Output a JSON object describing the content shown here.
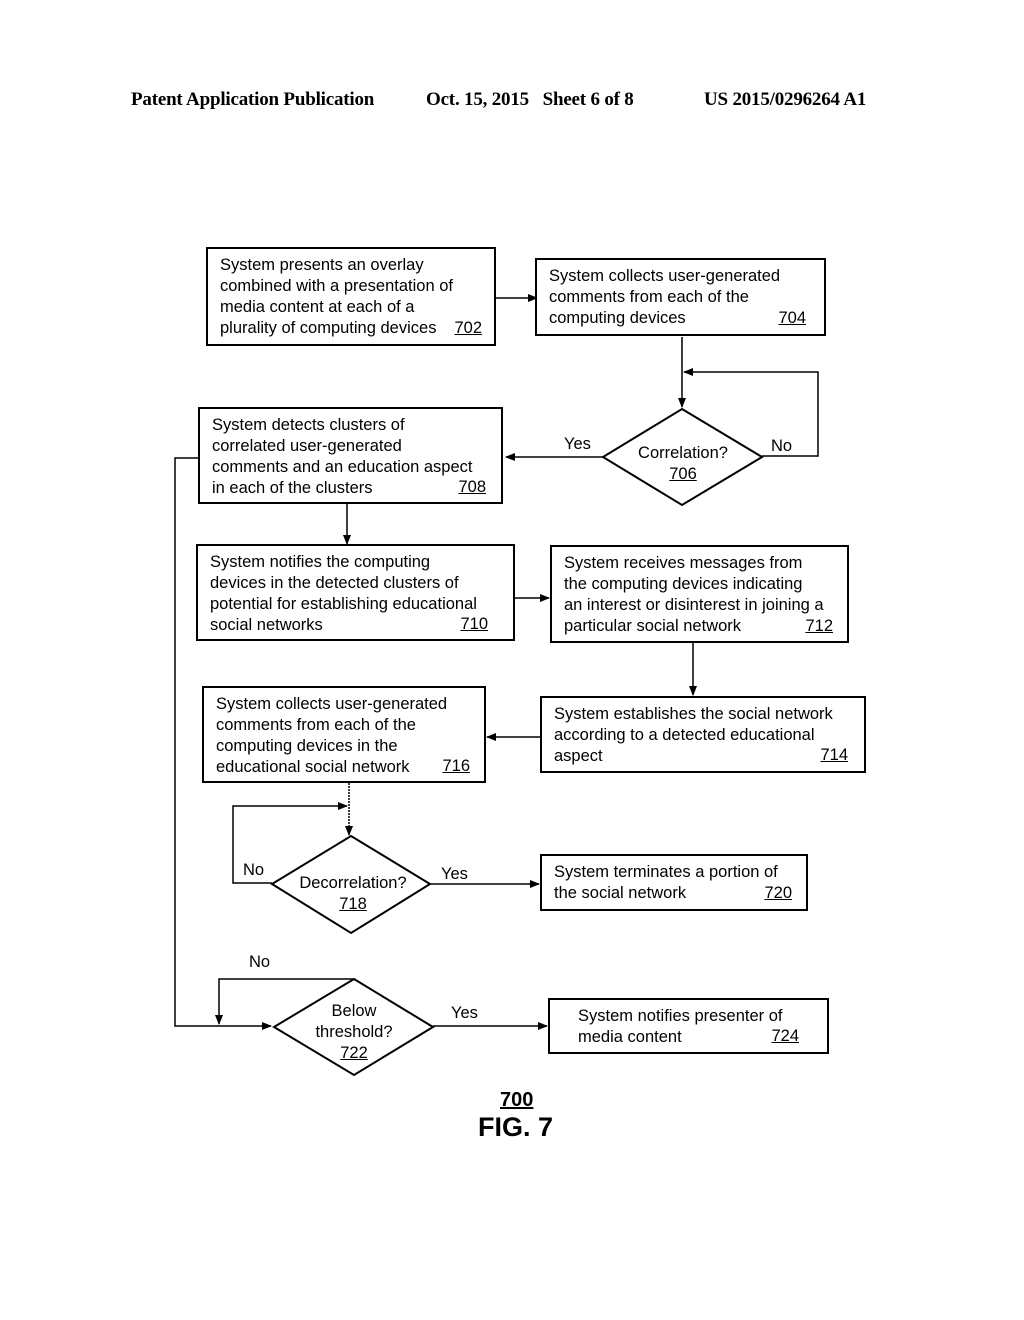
{
  "header": {
    "publication": "Patent Application Publication",
    "date_sheet": "Oct. 15, 2015   Sheet 6 of 8",
    "number": "US 2015/0296264 A1"
  },
  "nodes": {
    "n702": {
      "type": "process",
      "lines": [
        "System presents an overlay",
        "combined with a presentation of",
        "media content at each of a",
        "plurality of computing devices"
      ],
      "ref": "702"
    },
    "n704": {
      "type": "process",
      "lines": [
        "System collects user-generated",
        "comments from each of the",
        "computing devices"
      ],
      "ref": "704"
    },
    "n706": {
      "type": "decision",
      "lines": [
        "Correlation?"
      ],
      "ref": "706"
    },
    "n708": {
      "type": "process",
      "lines": [
        "System detects clusters of",
        "correlated user-generated",
        "comments and an education aspect",
        "in each of the clusters"
      ],
      "ref": "708"
    },
    "n710": {
      "type": "process",
      "lines": [
        "System notifies the computing",
        "devices in the detected clusters of",
        "potential for establishing  educational",
        "social networks"
      ],
      "ref": "710"
    },
    "n712": {
      "type": "process",
      "lines": [
        "System receives messages from",
        "the computing devices indicating",
        "an interest or disinterest in joining a",
        "particular social network"
      ],
      "ref": "712"
    },
    "n714": {
      "type": "process",
      "lines": [
        "System establishes the social network",
        "according to a detected educational",
        "aspect"
      ],
      "ref": "714"
    },
    "n716": {
      "type": "process",
      "lines": [
        "System collects user-generated",
        "comments from each of the",
        "computing devices  in the",
        "educational social network"
      ],
      "ref": "716"
    },
    "n718": {
      "type": "decision",
      "lines": [
        "Decorrelation?"
      ],
      "ref": "718"
    },
    "n720": {
      "type": "process",
      "lines": [
        "System terminates a portion of",
        "the social network"
      ],
      "ref": "720"
    },
    "n722": {
      "type": "decision",
      "lines": [
        "Below",
        "threshold?"
      ],
      "ref": "722"
    },
    "n724": {
      "type": "process",
      "lines": [
        "System notifies presenter of",
        "media content"
      ],
      "ref": "724"
    }
  },
  "edges": [
    {
      "from": "702",
      "to": "704",
      "label": ""
    },
    {
      "from": "704",
      "to": "706",
      "label": ""
    },
    {
      "from": "706",
      "to": "708",
      "label": "Yes"
    },
    {
      "from": "706",
      "to": "706",
      "label": "No"
    },
    {
      "from": "708",
      "to": "710",
      "label": ""
    },
    {
      "from": "708",
      "to": "722",
      "label": ""
    },
    {
      "from": "710",
      "to": "712",
      "label": ""
    },
    {
      "from": "712",
      "to": "714",
      "label": ""
    },
    {
      "from": "714",
      "to": "716",
      "label": ""
    },
    {
      "from": "716",
      "to": "718",
      "label": ""
    },
    {
      "from": "718",
      "to": "720",
      "label": "Yes"
    },
    {
      "from": "718",
      "to": "718",
      "label": "No"
    },
    {
      "from": "722",
      "to": "724",
      "label": "Yes"
    },
    {
      "from": "722",
      "to": "722",
      "label": "No"
    }
  ],
  "edge_labels": {
    "yes_706": "Yes",
    "no_706": "No",
    "yes_718": "Yes",
    "no_718": "No",
    "yes_722": "Yes",
    "no_722": "No"
  },
  "figure": {
    "ref": "700",
    "title": "FIG. 7"
  }
}
